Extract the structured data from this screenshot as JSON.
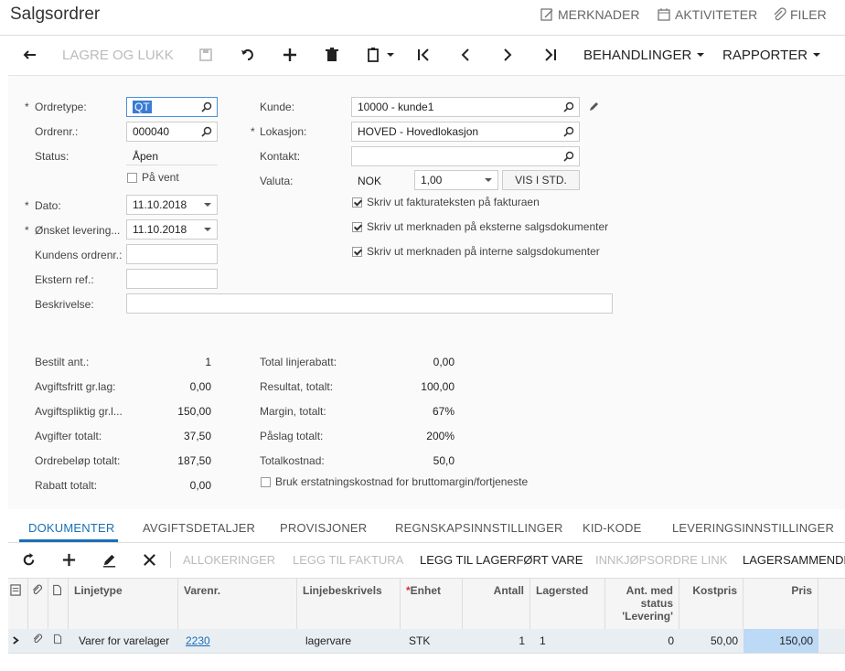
{
  "title": "Salgsordrer",
  "header_actions": {
    "notes": "MERKNADER",
    "activities": "AKTIVITETER",
    "files": "FILER"
  },
  "toolbar": {
    "save_close": "LAGRE OG LUKK",
    "processes": "BEHANDLINGER",
    "reports": "RAPPORTER"
  },
  "form": {
    "order_type": {
      "label": "Ordretype:",
      "value": "QT"
    },
    "order_nbr": {
      "label": "Ordrenr.:",
      "value": "000040"
    },
    "status": {
      "label": "Status:",
      "value": "Åpen"
    },
    "hold": {
      "label": "På vent"
    },
    "date": {
      "label": "Dato:",
      "value": "11.10.2018"
    },
    "requested": {
      "label": "Ønsket levering...",
      "value": "11.10.2018"
    },
    "customer_order": {
      "label": "Kundens ordrenr.:",
      "value": ""
    },
    "external_ref": {
      "label": "Ekstern ref.:",
      "value": ""
    },
    "description": {
      "label": "Beskrivelse:",
      "value": ""
    },
    "customer": {
      "label": "Kunde:",
      "value": "10000 - kunde1"
    },
    "location": {
      "label": "Lokasjon:",
      "value": "HOVED - Hovedlokasjon"
    },
    "contact": {
      "label": "Kontakt:",
      "value": ""
    },
    "currency": {
      "label": "Valuta:",
      "code": "NOK",
      "rate": "1,00",
      "button": "VIS I STD."
    },
    "print_invoice_text": {
      "label": "Skriv ut fakturateksten på fakturaen",
      "checked": true
    },
    "print_note_external": {
      "label": "Skriv ut merknaden på eksterne salgsdokumenter",
      "checked": true
    },
    "print_note_internal": {
      "label": "Skriv ut merknaden på interne salgsdokumenter",
      "checked": true
    }
  },
  "totals_left": [
    {
      "label": "Bestilt ant.:",
      "value": "1"
    },
    {
      "label": "Avgiftsfritt gr.lag:",
      "value": "0,00"
    },
    {
      "label": "Avgiftspliktig gr.l...",
      "value": "150,00"
    },
    {
      "label": "Avgifter totalt:",
      "value": "37,50"
    },
    {
      "label": "Ordrebeløp totalt:",
      "value": "187,50"
    },
    {
      "label": "Rabatt totalt:",
      "value": "0,00"
    }
  ],
  "totals_right": [
    {
      "label": "Total linjerabatt:",
      "value": "0,00"
    },
    {
      "label": "Resultat, totalt:",
      "value": "100,00"
    },
    {
      "label": "Margin, totalt:",
      "value": "67%"
    },
    {
      "label": "Påslag totalt:",
      "value": "200%"
    },
    {
      "label": "Totalkostnad:",
      "value": "50,0"
    }
  ],
  "replacement_cost": {
    "label": "Bruk erstatningskostnad for bruttomargin/fortjeneste",
    "checked": false
  },
  "tabs": [
    "DOKUMENTER",
    "AVGIFTSDETALJER",
    "PROVISJONER",
    "REGNSKAPSINNSTILLINGER",
    "KID-KODE",
    "LEVERINGSINNSTILLINGER"
  ],
  "grid_toolbar": {
    "allocations": "ALLOKERINGER",
    "add_invoice": "LEGG TIL FAKTURA",
    "add_stock_item": "LEGG TIL LAGERFØRT VARE",
    "po_link": "INNKJØPSORDRE LINK",
    "inventory_summary": "LAGERSAMMENDRA"
  },
  "grid": {
    "headers": {
      "line_type": "Linjetype",
      "item": "Varenr.",
      "desc": "Linjebeskrivels",
      "uom": "Enhet",
      "qty": "Antall",
      "warehouse": "Lagersted",
      "ship_status_1": "Ant. med",
      "ship_status_2": "status",
      "ship_status_3": "'Levering'",
      "cost": "Kostpris",
      "price": "Pris"
    },
    "rows": [
      {
        "line_type": "Varer for varelager",
        "item": "2230",
        "desc": "lagervare",
        "uom": "STK",
        "qty": "1",
        "warehouse": "1",
        "ship_qty": "0",
        "cost": "50,00",
        "price": "150,00"
      }
    ]
  },
  "accent": "#1a6fb6"
}
